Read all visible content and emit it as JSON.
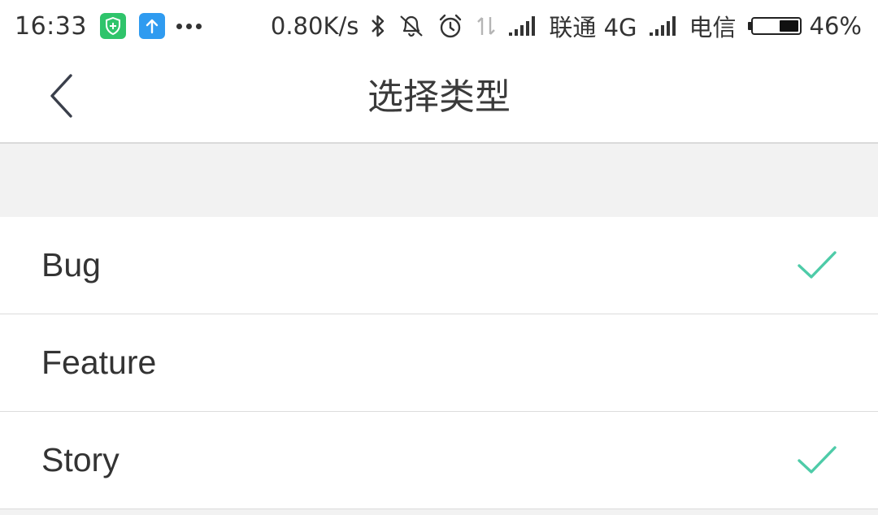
{
  "status_bar": {
    "time": "16:33",
    "speed": "0.80K/s",
    "carrier1": "联通 4G",
    "carrier2": "电信",
    "battery_text": "46%",
    "battery_level_percent": 46,
    "icons": [
      "shield-app-icon",
      "upload-app-icon",
      "more-dots-icon",
      "bluetooth-icon",
      "bell-off-icon",
      "alarm-icon",
      "data-arrows-icon",
      "signal-icon",
      "signal-icon",
      "battery-icon"
    ],
    "colors": {
      "shield_app": "#2fc46b",
      "upload_app": "#2f9bf0"
    }
  },
  "nav": {
    "title": "选择类型",
    "back_icon": "chevron-left-icon"
  },
  "list": {
    "items": [
      {
        "label": "Bug",
        "checked": true
      },
      {
        "label": "Feature",
        "checked": false
      },
      {
        "label": "Story",
        "checked": true
      }
    ],
    "check_color": "#4ecba8",
    "check_icon": "check-icon"
  }
}
